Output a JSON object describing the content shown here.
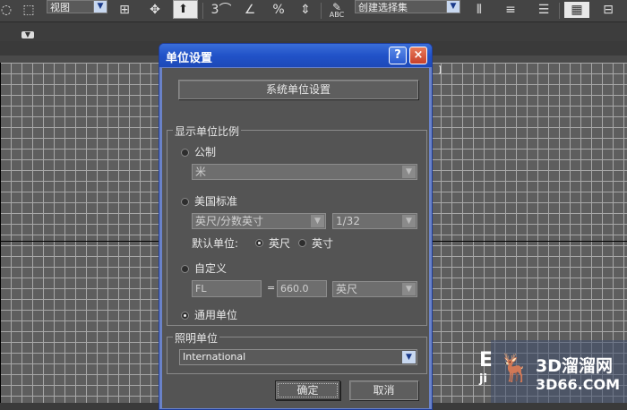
{
  "toolbar": {
    "view_combo": "视图",
    "selection_set_combo": "创建选择集",
    "snap_toggle_3": "3",
    "abc_label": "ABC"
  },
  "dialog": {
    "title": "单位设置",
    "help_label": "?",
    "close_label": "×",
    "system_unit_button": "系统单位设置",
    "display_group_title": "显示单位比例",
    "metric": {
      "label": "公制",
      "value": "米"
    },
    "us_standard": {
      "label": "美国标准",
      "value": "英尺/分数英寸",
      "fraction": "1/32",
      "default_unit_label": "默认单位:",
      "feet_label": "英尺",
      "inch_label": "英寸"
    },
    "custom": {
      "label": "自定义",
      "name_value": "FL",
      "equals": "=",
      "number_value": "660.0",
      "unit_value": "英尺"
    },
    "generic_label": "通用单位",
    "lighting_group_title": "照明单位",
    "lighting_value": "International",
    "ok_label": "确定",
    "cancel_label": "取消",
    "selected_scale": "generic"
  },
  "watermark": {
    "site_name": "3D溜溜网",
    "site_url": "3D66.COM",
    "left_fragment": "E",
    "left_fragment_2": "ji"
  },
  "viewport": {
    "bracket": "]"
  },
  "colors": {
    "title_bar": "#2152c8",
    "dialog_bg": "#545454",
    "close": "#c8402a"
  }
}
